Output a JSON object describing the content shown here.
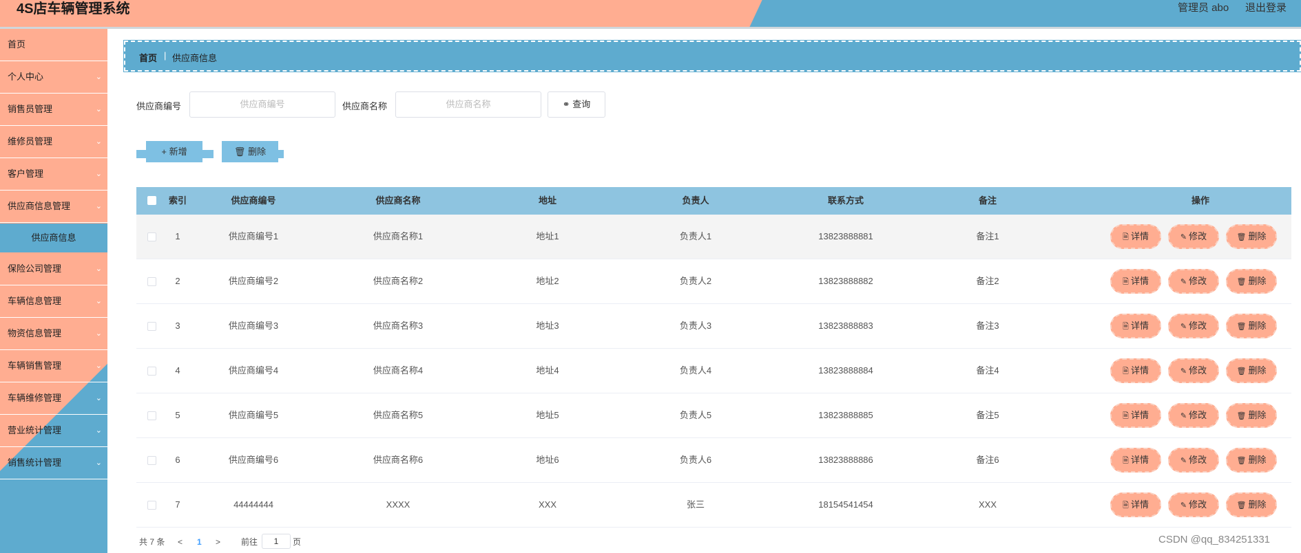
{
  "header": {
    "title": "4S店车辆管理系统",
    "user": "管理员 abo",
    "logout": "退出登录"
  },
  "sidebar": {
    "items": [
      {
        "label": "首页",
        "has_chevron": false
      },
      {
        "label": "个人中心",
        "has_chevron": true
      },
      {
        "label": "销售员管理",
        "has_chevron": true
      },
      {
        "label": "维修员管理",
        "has_chevron": true
      },
      {
        "label": "客户管理",
        "has_chevron": true
      },
      {
        "label": "供应商信息管理",
        "has_chevron": true
      },
      {
        "label": "保险公司管理",
        "has_chevron": true
      },
      {
        "label": "车辆信息管理",
        "has_chevron": true
      },
      {
        "label": "物资信息管理",
        "has_chevron": true
      },
      {
        "label": "车辆销售管理",
        "has_chevron": true
      },
      {
        "label": "车辆维修管理",
        "has_chevron": true
      },
      {
        "label": "营业统计管理",
        "has_chevron": true
      },
      {
        "label": "销售统计管理",
        "has_chevron": true
      }
    ],
    "active_sub": "供应商信息",
    "chevron_icon": "chevron-down-icon"
  },
  "breadcrumb": {
    "home": "首页",
    "current": "供应商信息"
  },
  "search": {
    "code_label": "供应商编号",
    "code_placeholder": "供应商编号",
    "name_label": "供应商名称",
    "name_placeholder": "供应商名称",
    "button": "查询",
    "button_icon": "search-icon"
  },
  "actions": {
    "add": "新增",
    "add_icon": "plus-icon",
    "delete": "删除",
    "delete_icon": "trash-icon"
  },
  "table": {
    "columns": [
      "索引",
      "供应商编号",
      "供应商名称",
      "地址",
      "负责人",
      "联系方式",
      "备注",
      "操作"
    ],
    "rows": [
      [
        "1",
        "供应商编号1",
        "供应商名称1",
        "地址1",
        "负责人1",
        "13823888881",
        "备注1"
      ],
      [
        "2",
        "供应商编号2",
        "供应商名称2",
        "地址2",
        "负责人2",
        "13823888882",
        "备注2"
      ],
      [
        "3",
        "供应商编号3",
        "供应商名称3",
        "地址3",
        "负责人3",
        "13823888883",
        "备注3"
      ],
      [
        "4",
        "供应商编号4",
        "供应商名称4",
        "地址4",
        "负责人4",
        "13823888884",
        "备注4"
      ],
      [
        "5",
        "供应商编号5",
        "供应商名称5",
        "地址5",
        "负责人5",
        "13823888885",
        "备注5"
      ],
      [
        "6",
        "供应商编号6",
        "供应商名称6",
        "地址6",
        "负责人6",
        "13823888886",
        "备注6"
      ],
      [
        "7",
        "44444444",
        "XXXX",
        "XXX",
        "张三",
        "18154541454",
        "XXX"
      ]
    ],
    "row_actions": [
      {
        "label": "详情",
        "icon": "document-icon"
      },
      {
        "label": "修改",
        "icon": "edit-icon"
      },
      {
        "label": "删除",
        "icon": "trash-icon"
      }
    ]
  },
  "pagination": {
    "total": "共 7 条",
    "current_page": "1",
    "goto_label": "前往",
    "goto_value": "1",
    "page_suffix": "页"
  },
  "watermark": "CSDN @qq_834251331",
  "colors": {
    "salmon": "#ffad91",
    "blue": "#5eabcf",
    "table_header": "#8ec4e0",
    "action_button": "#7ec0e3"
  }
}
